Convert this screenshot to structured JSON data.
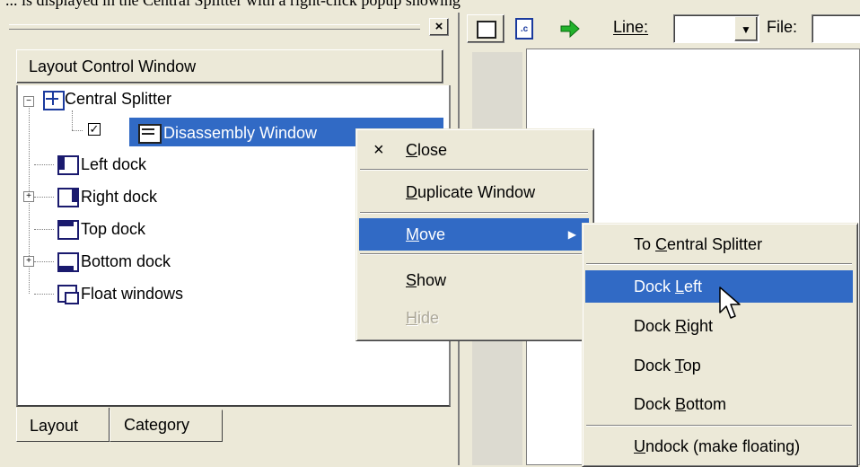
{
  "caption": "... is displayed in the Central Splitter with a right-click popup showing",
  "left_panel": {
    "close_symbol": "×",
    "header": "Layout Control Window",
    "tree": [
      {
        "label": "Central Splitter"
      },
      {
        "label": "Disassembly Window",
        "checked": true,
        "selected": true
      },
      {
        "label": "Left dock"
      },
      {
        "label": "Right dock"
      },
      {
        "label": "Top dock"
      },
      {
        "label": "Bottom dock"
      },
      {
        "label": "Float windows"
      }
    ],
    "tabs": [
      "Layout",
      "Category"
    ]
  },
  "toolbar": {
    "line_label": "Line:",
    "file_label": "File:",
    "line_value": "",
    "file_value": ""
  },
  "context_menu": {
    "close_mark": "×",
    "close": "Close",
    "duplicate": "Duplicate Window",
    "move": "Move",
    "show": "Show",
    "hide": "Hide"
  },
  "submenu": {
    "to_central": "To Central Splitter",
    "dock_left": "Dock Left",
    "dock_right": "Dock Right",
    "dock_top": "Dock Top",
    "dock_bottom": "Dock Bottom",
    "undock": "Undock (make floating)"
  },
  "colors": {
    "selection": "#316ac5",
    "face": "#ece9d8"
  }
}
